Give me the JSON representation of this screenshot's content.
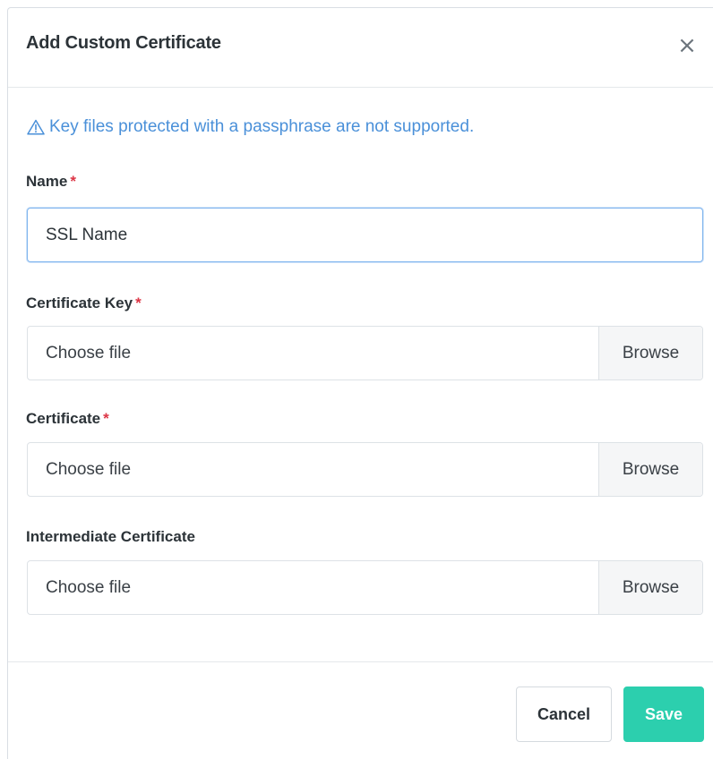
{
  "modal": {
    "title": "Add Custom Certificate",
    "close_glyph": "×",
    "warning_icon": "warning-triangle-icon",
    "warning_text": "Key files protected with a passphrase are not supported."
  },
  "fields": {
    "name": {
      "label": "Name",
      "required_mark": "*",
      "value": "SSL Name"
    },
    "certificate_key": {
      "label": "Certificate Key",
      "required_mark": "*",
      "placeholder": "Choose file",
      "browse_label": "Browse"
    },
    "certificate": {
      "label": "Certificate",
      "required_mark": "*",
      "placeholder": "Choose file",
      "browse_label": "Browse"
    },
    "intermediate_certificate": {
      "label": "Intermediate Certificate",
      "placeholder": "Choose file",
      "browse_label": "Browse"
    }
  },
  "footer": {
    "cancel_label": "Cancel",
    "save_label": "Save"
  },
  "colors": {
    "accent": "#2ccfae",
    "info": "#4a90d9",
    "required": "#dc3545",
    "focus_border": "#7fb4ee"
  }
}
